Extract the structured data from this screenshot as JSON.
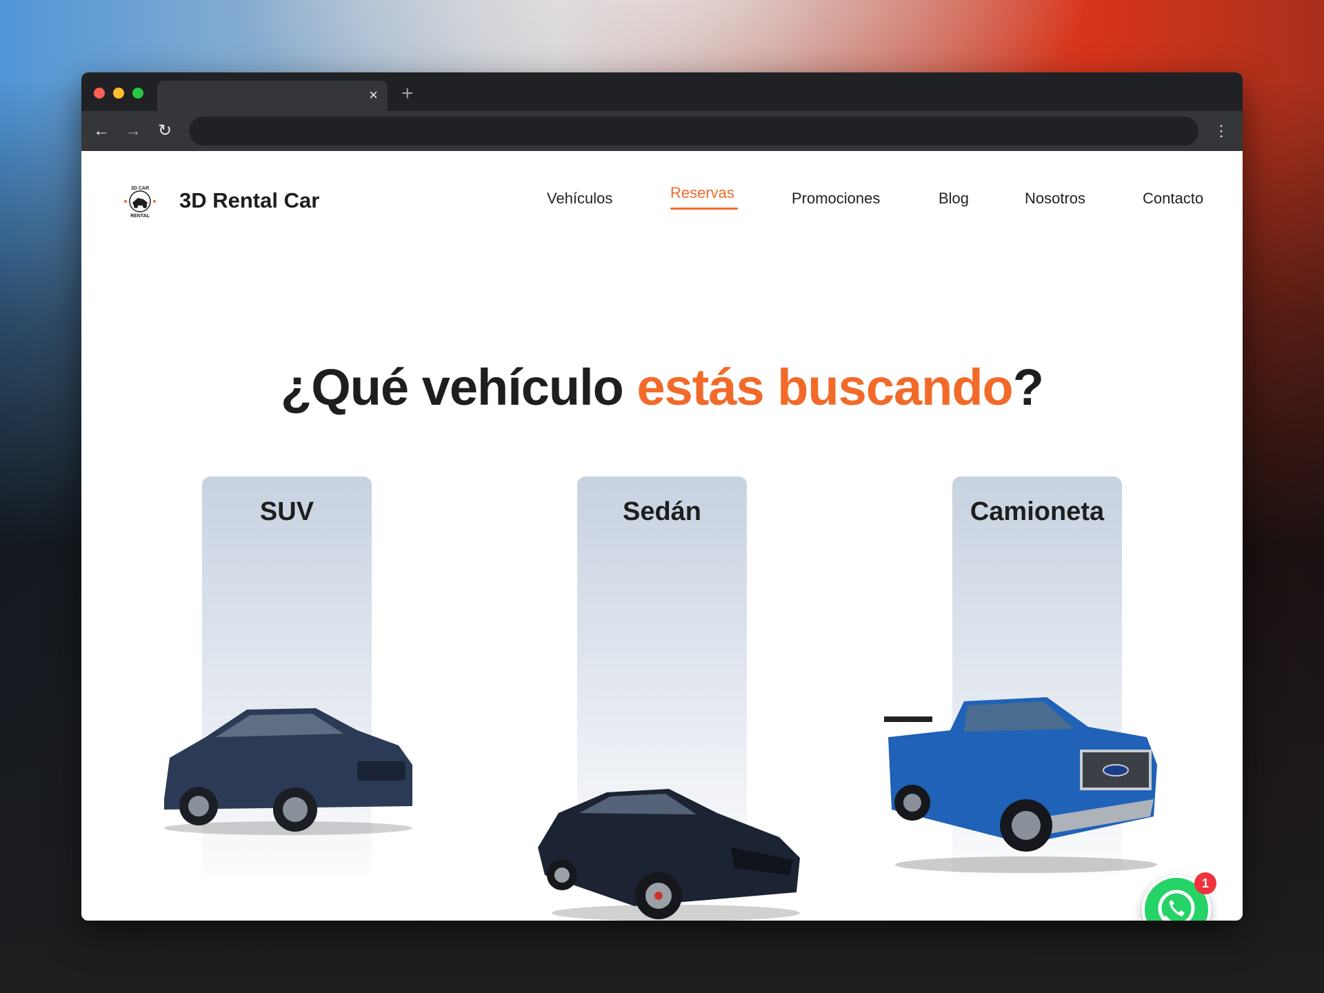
{
  "browser": {
    "tab_close_glyph": "×",
    "new_tab_glyph": "+",
    "back_glyph": "←",
    "forward_glyph": "→",
    "reload_glyph": "↻",
    "menu_glyph": "⋮"
  },
  "header": {
    "logo_text_top": "3D CAR",
    "logo_text_bottom": "RENTAL",
    "brand": "3D Rental Car",
    "nav": [
      {
        "label": "Vehículos",
        "active": false
      },
      {
        "label": "Reservas",
        "active": true
      },
      {
        "label": "Promociones",
        "active": false
      },
      {
        "label": "Blog",
        "active": false
      },
      {
        "label": "Nosotros",
        "active": false
      },
      {
        "label": "Contacto",
        "active": false
      }
    ]
  },
  "hero": {
    "title_start": "¿Qué vehículo ",
    "title_accent": "estás buscando",
    "title_end": "?"
  },
  "categories": [
    {
      "label": "SUV",
      "image": "suv-image"
    },
    {
      "label": "Sedán",
      "image": "sedan-image"
    },
    {
      "label": "Camioneta",
      "image": "pickup-truck-image"
    }
  ],
  "whatsapp": {
    "badge_count": "1",
    "icon": "whatsapp-icon"
  },
  "colors": {
    "accent": "#f26a2a",
    "whatsapp": "#25d366",
    "badge": "#f0323e",
    "browser_chrome": "#202124"
  }
}
